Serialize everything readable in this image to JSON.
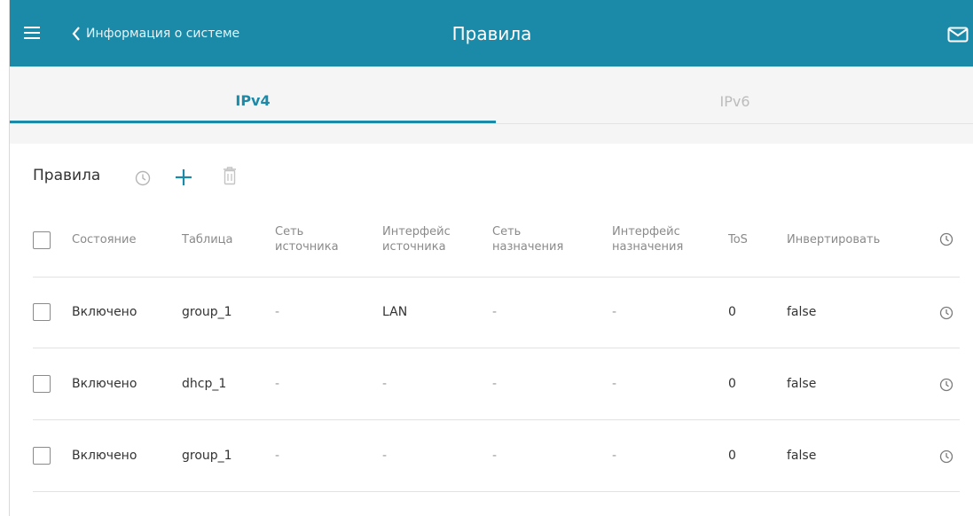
{
  "header": {
    "back_label": "Информация о системе",
    "title": "Правила",
    "bg_color": "#1a8aa8"
  },
  "tabs": [
    {
      "label": "IPv4",
      "active": true
    },
    {
      "label": "IPv6",
      "active": false
    }
  ],
  "section": {
    "title": "Правила",
    "icons": [
      "clock-icon",
      "add-icon",
      "trash-icon"
    ]
  },
  "table": {
    "columns": [
      {
        "line1": "Состояние",
        "line2": ""
      },
      {
        "line1": "Таблица",
        "line2": ""
      },
      {
        "line1": "Сеть",
        "line2": "источника"
      },
      {
        "line1": "Интерфейс",
        "line2": "источника"
      },
      {
        "line1": "Сеть",
        "line2": "назначения"
      },
      {
        "line1": "Интерфейс",
        "line2": "назначения"
      },
      {
        "line1": "ToS",
        "line2": ""
      },
      {
        "line1": "Инвертировать",
        "line2": ""
      }
    ],
    "rows": [
      {
        "state": "Включено",
        "table": "group_1",
        "src_net": "-",
        "src_iface": "LAN",
        "dst_net": "-",
        "dst_iface": "-",
        "tos": "0",
        "invert": "false"
      },
      {
        "state": "Включено",
        "table": "dhcp_1",
        "src_net": "-",
        "src_iface": "-",
        "dst_net": "-",
        "dst_iface": "-",
        "tos": "0",
        "invert": "false"
      },
      {
        "state": "Включено",
        "table": "group_1",
        "src_net": "-",
        "src_iface": "-",
        "dst_net": "-",
        "dst_iface": "-",
        "tos": "0",
        "invert": "false"
      }
    ]
  }
}
